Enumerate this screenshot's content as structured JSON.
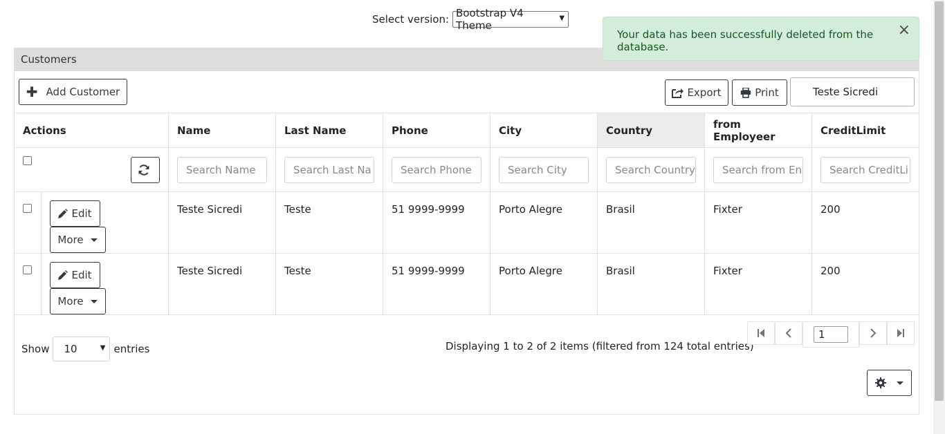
{
  "version_selector": {
    "label": "Select version:",
    "value": "Bootstrap V4 Theme"
  },
  "alert": {
    "message": "Your data has been successfully deleted from the database.",
    "close": "×"
  },
  "card": {
    "title": "Customers"
  },
  "toolbar": {
    "add_label": "Add Customer",
    "export_label": "Export",
    "print_label": "Print",
    "search_value": "Teste Sicredi"
  },
  "columns": [
    "Actions",
    "Name",
    "Last Name",
    "Phone",
    "City",
    "Country",
    "from Employeer",
    "CreditLimit"
  ],
  "filters": [
    "Search Name",
    "Search Last Na",
    "Search Phone",
    "Search City",
    "Search Country",
    "Search from En",
    "Search CreditLi"
  ],
  "row_actions": {
    "edit_label": "Edit",
    "more_label": "More"
  },
  "rows": [
    {
      "name": "Teste Sicredi",
      "last_name": "Teste",
      "phone": "51 9999-9999",
      "city": "Porto Alegre",
      "country": "Brasil",
      "employeer": "Fixter",
      "credit_limit": "200"
    },
    {
      "name": "Teste Sicredi",
      "last_name": "Teste",
      "phone": "51 9999-9999",
      "city": "Porto Alegre",
      "country": "Brasil",
      "employeer": "Fixter",
      "credit_limit": "200"
    }
  ],
  "footer": {
    "show_label": "Show",
    "page_size": "10",
    "entries_label": "entries",
    "info": "Displaying 1 to 2 of 2 items (filtered from 124 total entries)",
    "page_value": "1"
  },
  "colors": {
    "alert_bg": "#d4edda",
    "alert_text": "#155724",
    "header_bg": "#dcdcdc",
    "sorted_col_bg": "#ececec"
  }
}
